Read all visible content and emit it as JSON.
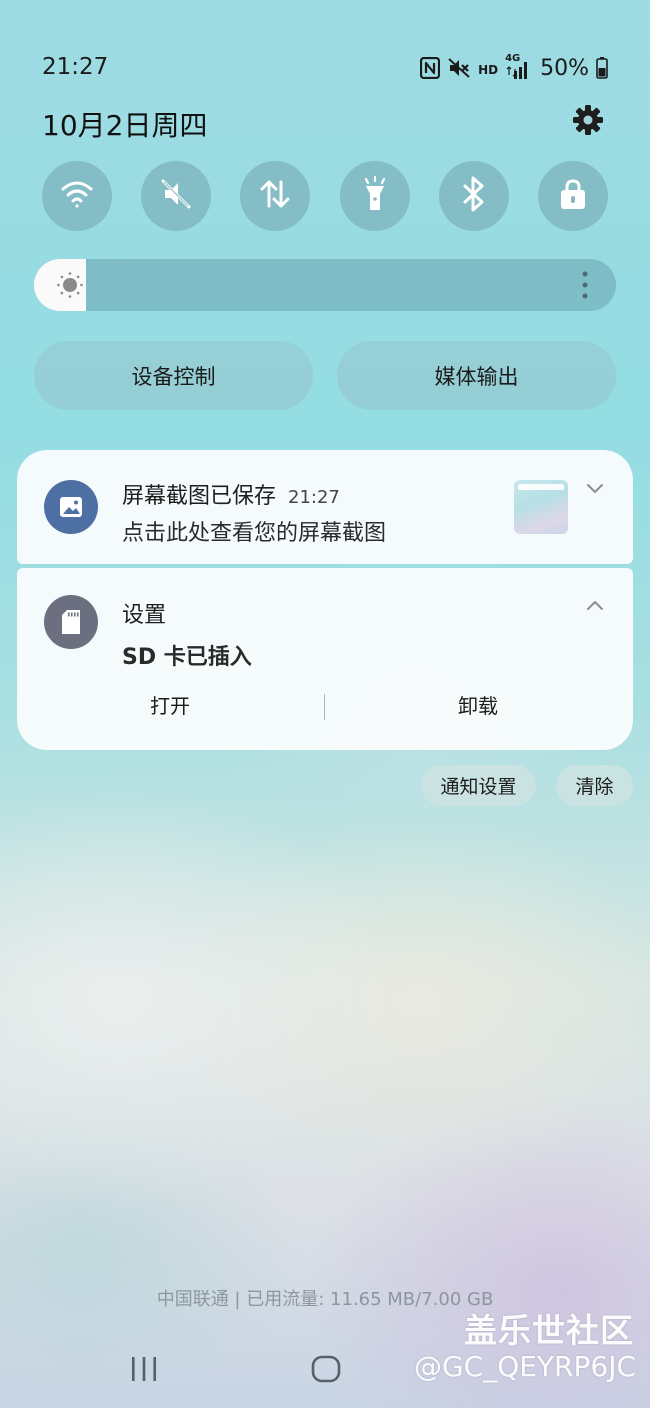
{
  "status_bar": {
    "time": "21:27",
    "icons": [
      "nfc-icon",
      "mute-icon",
      "hd-icon",
      "4g-signal-icon",
      "battery-icon"
    ],
    "hd_label": "HD",
    "network_label": "4G",
    "battery": "50%"
  },
  "header": {
    "date": "10月2日周四"
  },
  "quick_toggles": [
    {
      "name": "wifi",
      "icon": "wifi-icon"
    },
    {
      "name": "sound",
      "icon": "mute-icon"
    },
    {
      "name": "mobile-data",
      "icon": "data-arrows-icon"
    },
    {
      "name": "flashlight",
      "icon": "flashlight-icon"
    },
    {
      "name": "bluetooth",
      "icon": "bluetooth-icon"
    },
    {
      "name": "screen-lock",
      "icon": "lock-icon"
    }
  ],
  "brightness": {
    "level": 0.09
  },
  "panel_buttons": {
    "device_control": "设备控制",
    "media_output": "媒体输出"
  },
  "notifications": {
    "screenshot": {
      "title": "屏幕截图已保存",
      "time": "21:27",
      "body": "点击此处查看您的屏幕截图",
      "icon": "image-icon"
    },
    "sd_card": {
      "app": "设置",
      "body": "SD 卡已插入",
      "icon": "sd-card-icon",
      "actions": {
        "open": "打开",
        "unmount": "卸载"
      }
    }
  },
  "footer_buttons": {
    "notification_settings": "通知设置",
    "clear": "清除"
  },
  "carrier_info": "中国联通 | 已用流量: 11.65 MB/7.00 GB",
  "watermark": {
    "line1": "盖乐世社区",
    "line2": "@GC_QEYRP6JC"
  },
  "colors": {
    "screenshot_icon_bg": "#4e6fa3",
    "settings_icon_bg": "#6c6f80",
    "toggle_bg": "#628c96"
  }
}
